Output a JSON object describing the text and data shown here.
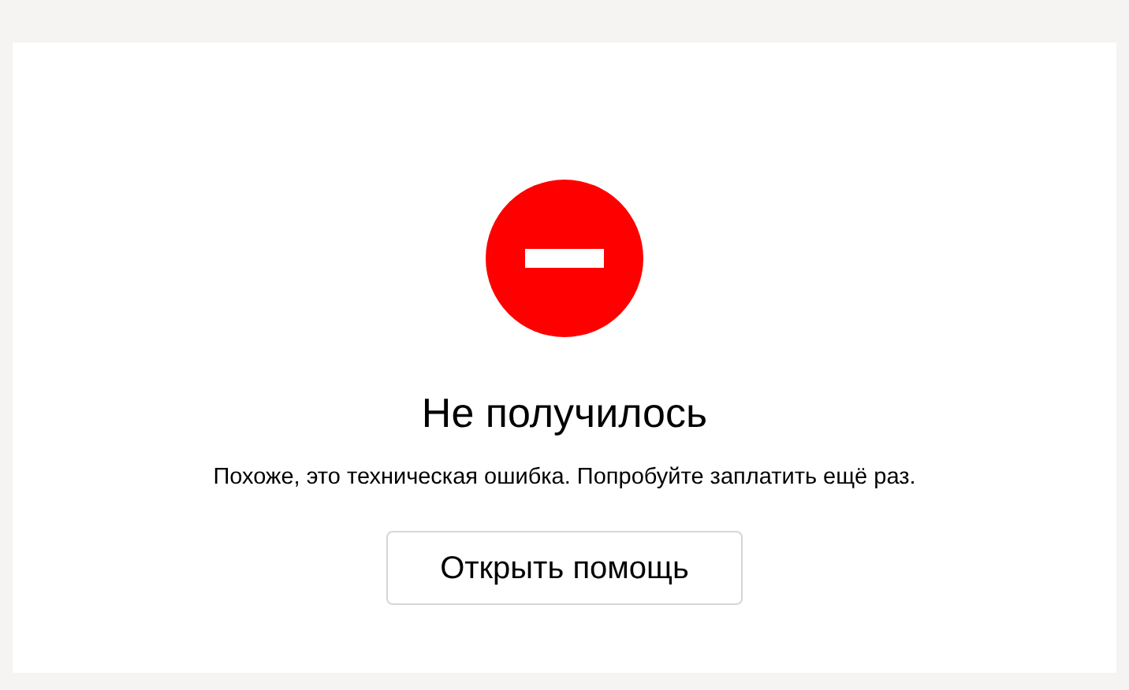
{
  "title": "Не получилось",
  "message": "Похоже, это техническая ошибка. Попробуйте заплатить ещё раз.",
  "button": "Открыть помощь"
}
